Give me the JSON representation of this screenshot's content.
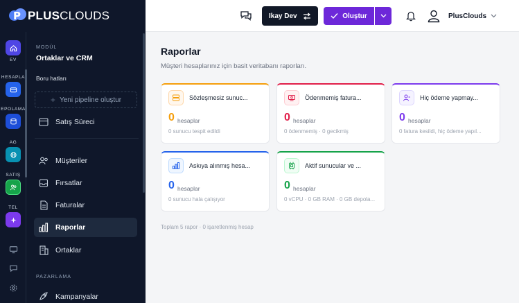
{
  "app": {
    "logo_bold": "PLUS",
    "logo_light": "CLOUDS",
    "logo_mark": "P"
  },
  "rail": {
    "items": [
      {
        "label": "EV",
        "icon": "home-icon",
        "color": "#4f46e5"
      },
      {
        "label": "HESAPLA",
        "icon": "wallet-icon",
        "color": "#2563eb"
      },
      {
        "label": "EPOLAMA",
        "icon": "database-icon",
        "color": "#1d4ed8"
      },
      {
        "label": "AĞ",
        "icon": "globe-icon",
        "color": "#0891b2"
      },
      {
        "label": "SATIŞ",
        "icon": "users-icon",
        "color": "#16a34a"
      },
      {
        "label": "TEL",
        "icon": "sparkle-icon",
        "color": "#7c3aed"
      }
    ]
  },
  "panel": {
    "module_caption": "MODÜL",
    "module_title": "Ortaklar ve CRM",
    "section_label": "Boru hatları",
    "new_pipeline": "Yeni pipeline oluştur",
    "sales_process": "Satış Süreci",
    "nav": [
      {
        "label": "Müşteriler",
        "icon": "users-icon"
      },
      {
        "label": "Fırsatlar",
        "icon": "inbox-icon"
      },
      {
        "label": "Faturalar",
        "icon": "invoice-icon"
      },
      {
        "label": "Raporlar",
        "icon": "bar-chart-icon"
      },
      {
        "label": "Ortaklar",
        "icon": "building-icon"
      }
    ],
    "marketing_caption": "PAZARLAMA",
    "campaigns": "Kampanyalar"
  },
  "topbar": {
    "user_label": "Ikay Dev",
    "create_label": "Oluştur",
    "account_name": "PlusClouds"
  },
  "main": {
    "title": "Raporlar",
    "subtitle": "Müşteri hesaplarınız için basit veritabanı raporları.",
    "footer": "Toplam 5 rapor · 0 işaretlenmiş hesap"
  },
  "reports": [
    {
      "name": "Sözleşmesiz sunuc...",
      "value": "0",
      "unit": "hesaplar",
      "desc": "0 sunucu tespit edildi",
      "accent": "#f59e0b",
      "icon": "server-icon"
    },
    {
      "name": "Ödenmemiş fatura...",
      "value": "0",
      "unit": "hesaplar",
      "desc": "0 ödenmemiş · 0 gecikmiş",
      "accent": "#e11d48",
      "icon": "receipt-icon"
    },
    {
      "name": "Hiç ödeme yapmay...",
      "value": "0",
      "unit": "hesaplar",
      "desc": "0 fatura kesildi, hiç ödeme yapıl...",
      "accent": "#7c3aed",
      "icon": "user-minus-icon"
    },
    {
      "name": "Askıya alınmış hesa...",
      "value": "0",
      "unit": "hesaplar",
      "desc": "0 sunucu hala çalışıyor",
      "accent": "#2563eb",
      "icon": "bar-chart-icon"
    },
    {
      "name": "Aktif sunucular ve ...",
      "value": "0",
      "unit": "hesaplar",
      "desc": "0 vCPU · 0 GB RAM · 0 GB depola...",
      "accent": "#16a34a",
      "icon": "cpu-icon"
    }
  ]
}
